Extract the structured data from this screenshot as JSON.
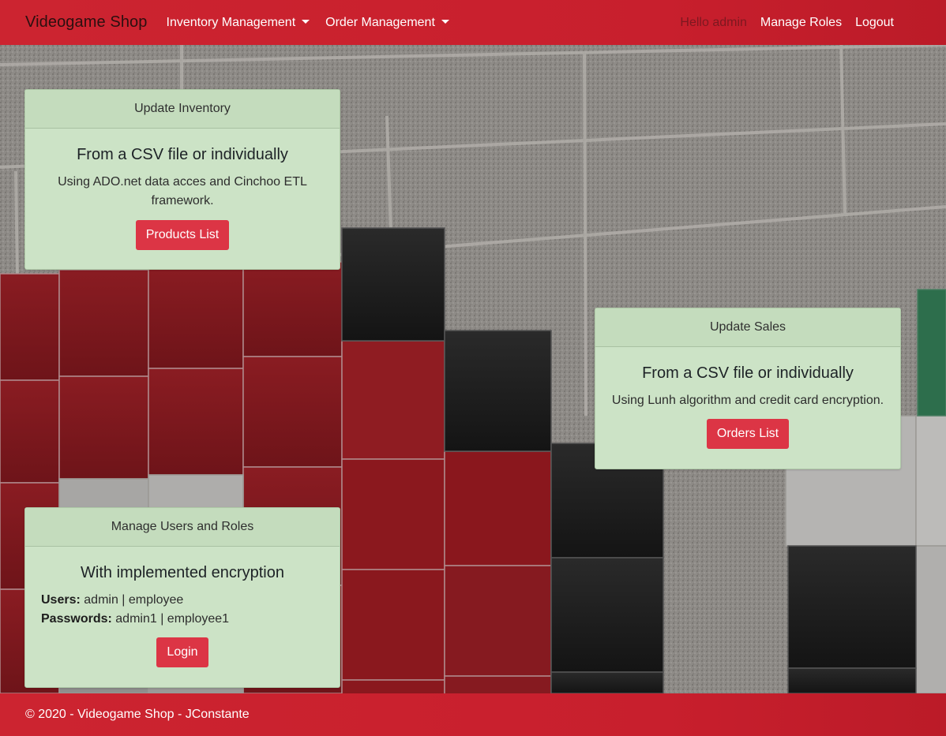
{
  "navbar": {
    "brand": "Videogame Shop",
    "inventory_menu": "Inventory Management",
    "order_menu": "Order Management",
    "greeting": "Hello admin",
    "manage_roles": "Manage Roles",
    "logout": "Logout"
  },
  "cards": {
    "inventory": {
      "header": "Update Inventory",
      "title": "From a CSV file or individually",
      "text": "Using ADO.net data acces and Cinchoo ETL framework.",
      "button": "Products List"
    },
    "sales": {
      "header": "Update Sales",
      "title": "From a CSV file or individually",
      "text": "Using Lunh algorithm and credit card encryption.",
      "button": "Orders List"
    },
    "users": {
      "header": "Manage Users and Roles",
      "title": "With implemented encryption",
      "users_label": "Users:",
      "users_value": "admin | employee",
      "passwords_label": "Passwords:",
      "passwords_value": "admin1 | employee1",
      "button": "Login"
    }
  },
  "footer": {
    "text": "© 2020 - Videogame Shop - JConstante"
  },
  "colors": {
    "brand_red": "#c8202d",
    "button_red": "#dc3545",
    "card_green": "#cce3c6"
  }
}
